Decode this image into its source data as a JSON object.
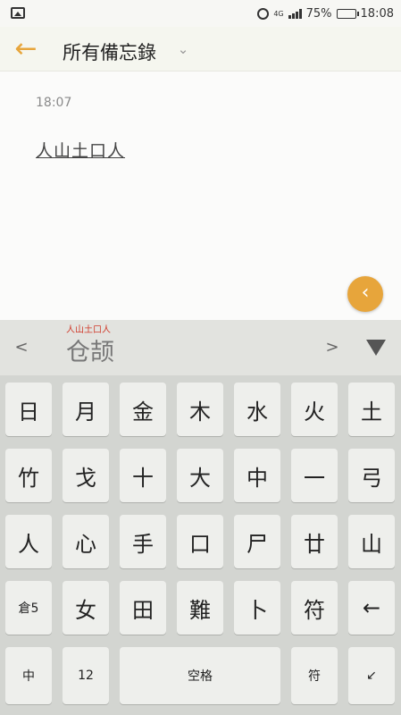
{
  "status_bar": {
    "network": "4G",
    "battery": "75%",
    "time": "18:08",
    "battery_level": 0.75
  },
  "header": {
    "title": "所有備忘錄"
  },
  "note": {
    "time": "18:07",
    "text": "人山土口人"
  },
  "candidates": {
    "composition": "人山土口人",
    "prev": "<",
    "word": "仓颉",
    "next": ">"
  },
  "keyboard": {
    "row1": [
      "日",
      "月",
      "金",
      "木",
      "水",
      "火",
      "土"
    ],
    "row2": [
      "竹",
      "戈",
      "十",
      "大",
      "中",
      "一",
      "弓"
    ],
    "row3": [
      "人",
      "心",
      "手",
      "口",
      "尸",
      "廿",
      "山"
    ],
    "row4": [
      "倉5",
      "女",
      "田",
      "難",
      "卜",
      "符",
      "←"
    ],
    "row5": {
      "zhong": "中",
      "num": "12",
      "space": "空格",
      "symbol": "符",
      "enter": "↙"
    }
  },
  "colors": {
    "accent": "#e7a53b",
    "keyboard_bg": "#d3d5d1",
    "key_bg": "#eeefec",
    "composition_red": "#d03a2a"
  },
  "icons": {
    "gallery": "gallery-icon",
    "alarm": "alarm-icon",
    "signal": "signal-icon",
    "battery": "battery-icon",
    "back": "back-arrow-icon",
    "dropdown": "chevron-down-icon",
    "fab": "chevron-left-icon",
    "collapse": "triangle-down-icon"
  }
}
